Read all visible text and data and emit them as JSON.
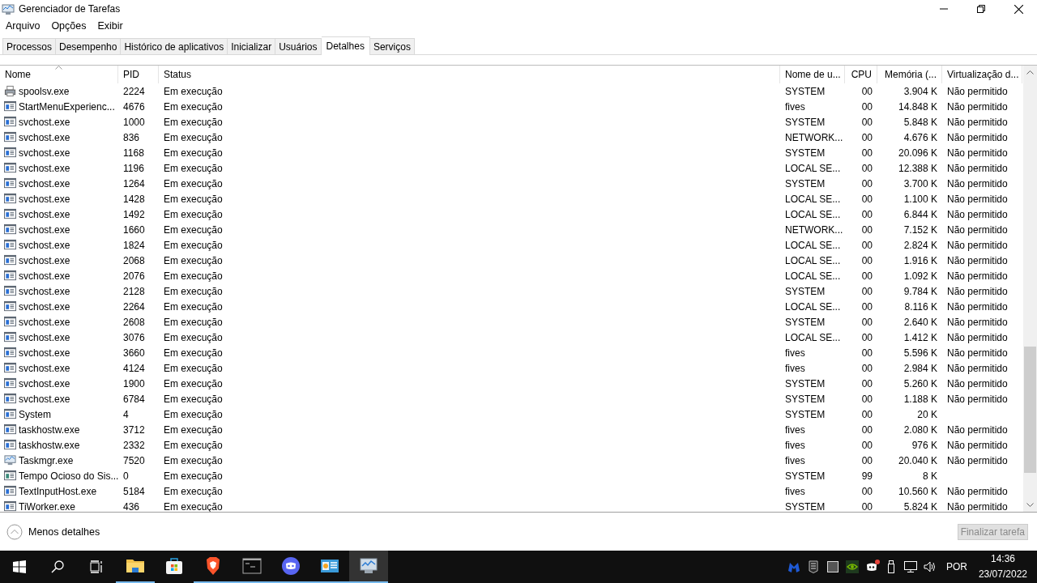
{
  "window": {
    "title": "Gerenciador de Tarefas"
  },
  "menu": [
    "Arquivo",
    "Opções",
    "Exibir"
  ],
  "tabs": [
    {
      "label": "Processos",
      "selected": false
    },
    {
      "label": "Desempenho",
      "selected": false
    },
    {
      "label": "Histórico de aplicativos",
      "selected": false
    },
    {
      "label": "Inicializar",
      "selected": false
    },
    {
      "label": "Usuários",
      "selected": false
    },
    {
      "label": "Detalhes",
      "selected": true
    },
    {
      "label": "Serviços",
      "selected": false
    }
  ],
  "table": {
    "columns": [
      {
        "label": "Nome",
        "sorted": true
      },
      {
        "label": "PID",
        "sorted": false
      },
      {
        "label": "Status",
        "sorted": false
      },
      {
        "label": "Nome de u...",
        "sorted": false
      },
      {
        "label": "CPU",
        "sorted": false
      },
      {
        "label": "Memória (...",
        "sorted": false
      },
      {
        "label": "Virtualização d...",
        "sorted": false
      }
    ],
    "rows": [
      {
        "kind": "printer",
        "cells": [
          "spoolsv.exe",
          "2224",
          "Em execução",
          "SYSTEM",
          "00",
          "3.904 K",
          "Não permitido"
        ]
      },
      {
        "kind": "window",
        "cells": [
          "StartMenuExperienc...",
          "4676",
          "Em execução",
          "fives",
          "00",
          "14.848 K",
          "Não permitido"
        ]
      },
      {
        "kind": "window",
        "cells": [
          "svchost.exe",
          "1000",
          "Em execução",
          "SYSTEM",
          "00",
          "5.848 K",
          "Não permitido"
        ]
      },
      {
        "kind": "window",
        "cells": [
          "svchost.exe",
          "836",
          "Em execução",
          "NETWORK...",
          "00",
          "4.676 K",
          "Não permitido"
        ]
      },
      {
        "kind": "window",
        "cells": [
          "svchost.exe",
          "1168",
          "Em execução",
          "SYSTEM",
          "00",
          "20.096 K",
          "Não permitido"
        ]
      },
      {
        "kind": "window",
        "cells": [
          "svchost.exe",
          "1196",
          "Em execução",
          "LOCAL SE...",
          "00",
          "12.388 K",
          "Não permitido"
        ]
      },
      {
        "kind": "window",
        "cells": [
          "svchost.exe",
          "1264",
          "Em execução",
          "SYSTEM",
          "00",
          "3.700 K",
          "Não permitido"
        ]
      },
      {
        "kind": "window",
        "cells": [
          "svchost.exe",
          "1428",
          "Em execução",
          "LOCAL SE...",
          "00",
          "1.100 K",
          "Não permitido"
        ]
      },
      {
        "kind": "window",
        "cells": [
          "svchost.exe",
          "1492",
          "Em execução",
          "LOCAL SE...",
          "00",
          "6.844 K",
          "Não permitido"
        ]
      },
      {
        "kind": "window",
        "cells": [
          "svchost.exe",
          "1660",
          "Em execução",
          "NETWORK...",
          "00",
          "7.152 K",
          "Não permitido"
        ]
      },
      {
        "kind": "window",
        "cells": [
          "svchost.exe",
          "1824",
          "Em execução",
          "LOCAL SE...",
          "00",
          "2.824 K",
          "Não permitido"
        ]
      },
      {
        "kind": "window",
        "cells": [
          "svchost.exe",
          "2068",
          "Em execução",
          "LOCAL SE...",
          "00",
          "1.916 K",
          "Não permitido"
        ]
      },
      {
        "kind": "window",
        "cells": [
          "svchost.exe",
          "2076",
          "Em execução",
          "LOCAL SE...",
          "00",
          "1.092 K",
          "Não permitido"
        ]
      },
      {
        "kind": "window",
        "cells": [
          "svchost.exe",
          "2128",
          "Em execução",
          "SYSTEM",
          "00",
          "9.784 K",
          "Não permitido"
        ]
      },
      {
        "kind": "window",
        "cells": [
          "svchost.exe",
          "2264",
          "Em execução",
          "LOCAL SE...",
          "00",
          "8.116 K",
          "Não permitido"
        ]
      },
      {
        "kind": "window",
        "cells": [
          "svchost.exe",
          "2608",
          "Em execução",
          "SYSTEM",
          "00",
          "2.640 K",
          "Não permitido"
        ]
      },
      {
        "kind": "window",
        "cells": [
          "svchost.exe",
          "3076",
          "Em execução",
          "LOCAL SE...",
          "00",
          "1.412 K",
          "Não permitido"
        ]
      },
      {
        "kind": "window",
        "cells": [
          "svchost.exe",
          "3660",
          "Em execução",
          "fives",
          "00",
          "5.596 K",
          "Não permitido"
        ]
      },
      {
        "kind": "window",
        "cells": [
          "svchost.exe",
          "4124",
          "Em execução",
          "fives",
          "00",
          "2.984 K",
          "Não permitido"
        ]
      },
      {
        "kind": "window",
        "cells": [
          "svchost.exe",
          "1900",
          "Em execução",
          "SYSTEM",
          "00",
          "5.260 K",
          "Não permitido"
        ]
      },
      {
        "kind": "window",
        "cells": [
          "svchost.exe",
          "6784",
          "Em execução",
          "SYSTEM",
          "00",
          "1.188 K",
          "Não permitido"
        ]
      },
      {
        "kind": "window",
        "cells": [
          "System",
          "4",
          "Em execução",
          "SYSTEM",
          "00",
          "20 K",
          ""
        ]
      },
      {
        "kind": "window",
        "cells": [
          "taskhostw.exe",
          "3712",
          "Em execução",
          "fives",
          "00",
          "2.080 K",
          "Não permitido"
        ]
      },
      {
        "kind": "window",
        "cells": [
          "taskhostw.exe",
          "2332",
          "Em execução",
          "fives",
          "00",
          "976 K",
          "Não permitido"
        ]
      },
      {
        "kind": "monitor",
        "cells": [
          "Taskmgr.exe",
          "7520",
          "Em execução",
          "fives",
          "00",
          "20.040 K",
          "Não permitido"
        ]
      },
      {
        "kind": "idle",
        "cells": [
          "Tempo Ocioso do Sis...",
          "0",
          "Em execução",
          "SYSTEM",
          "99",
          "8 K",
          ""
        ]
      },
      {
        "kind": "window",
        "cells": [
          "TextInputHost.exe",
          "5184",
          "Em execução",
          "fives",
          "00",
          "10.560 K",
          "Não permitido"
        ]
      },
      {
        "kind": "window",
        "cells": [
          "TiWorker.exe",
          "436",
          "Em execução",
          "SYSTEM",
          "00",
          "5.824 K",
          "Não permitido"
        ]
      }
    ]
  },
  "footer": {
    "toggle": "Menos detalhes",
    "end_task": {
      "label": "Finalizar tarefa",
      "disabled": true
    }
  },
  "taskbar": {
    "apps": [
      {
        "kind": "folder",
        "running": true,
        "active": false
      },
      {
        "kind": "store",
        "running": false,
        "active": false
      },
      {
        "kind": "lion",
        "running": true,
        "active": false
      },
      {
        "kind": "terminal",
        "running": true,
        "active": false
      },
      {
        "kind": "chat",
        "running": true,
        "active": false
      },
      {
        "kind": "panel",
        "running": true,
        "active": false
      },
      {
        "kind": "monitor",
        "running": true,
        "active": true
      }
    ],
    "tray": [
      {
        "kind": "shield",
        "badge": false
      },
      {
        "kind": "epic",
        "badge": false
      },
      {
        "kind": "grid",
        "badge": false
      },
      {
        "kind": "gpu",
        "badge": false
      },
      {
        "kind": "chat",
        "badge": true
      },
      {
        "kind": "usb",
        "badge": false
      },
      {
        "kind": "network",
        "badge": false
      },
      {
        "kind": "volume",
        "badge": false
      }
    ],
    "language": "POR",
    "time": "14:36",
    "date": "23/07/2022"
  }
}
